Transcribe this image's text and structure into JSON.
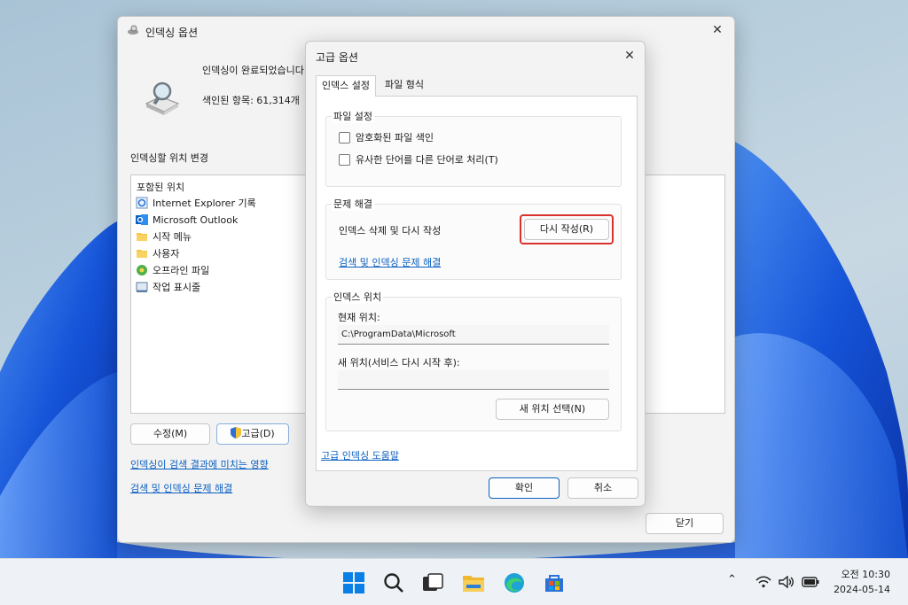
{
  "main_window": {
    "title": "인덱싱 옵션",
    "status": "인덱싱이 완료되었습니다",
    "indexed_count": "색인된 항목: 61,314개",
    "section_label": "인덱싱할 위치 변경",
    "list_header": "포함된 위치",
    "locations": [
      {
        "label": "Internet Explorer 기록",
        "icon": "ie-history-icon"
      },
      {
        "label": "Microsoft Outlook",
        "icon": "outlook-icon"
      },
      {
        "label": "시작 메뉴",
        "icon": "folder-icon"
      },
      {
        "label": "사용자",
        "icon": "folder-icon"
      },
      {
        "label": "오프라인 파일",
        "icon": "offline-files-icon"
      },
      {
        "label": "작업 표시줄",
        "icon": "taskbar-icon"
      }
    ],
    "modify_button": "수정(M)",
    "advanced_button": "고급(D)",
    "link_results": "인덱싱이 검색 결과에 미치는 영향",
    "link_troubleshoot": "검색 및 인덱싱 문제 해결",
    "close_button": "닫기"
  },
  "dialog": {
    "title": "고급 옵션",
    "tabs": [
      {
        "label": "인덱스 설정",
        "active": true
      },
      {
        "label": "파일 형식",
        "active": false
      }
    ],
    "file_settings": {
      "label": "파일 설정",
      "checkboxes": [
        {
          "label": "암호화된 파일 색인",
          "checked": false
        },
        {
          "label": "유사한 단어를 다른 단어로 처리(T)",
          "checked": false
        }
      ]
    },
    "troubleshooting": {
      "label": "문제 해결",
      "text": "인덱스 삭제 및 다시 작성",
      "rebuild_button": "다시 작성(R)",
      "link": "검색 및 인덱싱 문제 해결"
    },
    "index_location": {
      "label": "인덱스 위치",
      "current_label": "현재 위치:",
      "current_value": "C:\\ProgramData\\Microsoft",
      "new_label": "새 위치(서비스 다시 시작 후):",
      "new_value": "",
      "select_button": "새 위치 선택(N)"
    },
    "help_link": "고급 인덱싱 도움말",
    "ok_button": "확인",
    "cancel_button": "취소"
  },
  "taskbar": {
    "apps": [
      "start-icon",
      "search-icon",
      "task-view-icon",
      "file-explorer-icon",
      "edge-icon",
      "store-icon"
    ],
    "time": "오전 10:30",
    "date": "2024-05-14"
  },
  "colors": {
    "accent": "#0a5fbf",
    "highlight": "#d9322c"
  }
}
